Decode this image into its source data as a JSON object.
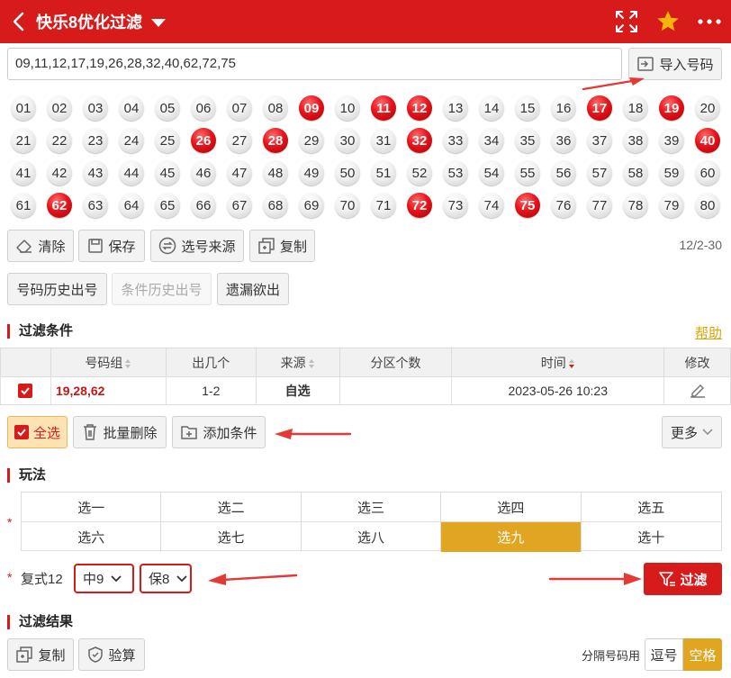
{
  "header": {
    "title": "快乐8优化过滤"
  },
  "input": {
    "value": "09,11,12,17,19,26,28,32,40,62,72,75"
  },
  "buttons": {
    "import": "导入号码",
    "clear": "清除",
    "save": "保存",
    "source": "选号来源",
    "copy": "复制",
    "num_history": "号码历史出号",
    "cond_history": "条件历史出号",
    "missing": "遗漏欲出",
    "select_all": "全选",
    "batch_delete": "批量删除",
    "add_condition": "添加条件",
    "more": "更多",
    "filter": "过滤",
    "copy_result": "复制",
    "verify": "验算"
  },
  "balls": {
    "rows": [
      [
        "01",
        "02",
        "03",
        "04",
        "05",
        "06",
        "07",
        "08",
        "09",
        "10",
        "11",
        "12",
        "13",
        "14",
        "15",
        "16",
        "17",
        "18",
        "19",
        "20"
      ],
      [
        "21",
        "22",
        "23",
        "24",
        "25",
        "26",
        "27",
        "28",
        "29",
        "30",
        "31",
        "32",
        "33",
        "34",
        "35",
        "36",
        "37",
        "38",
        "39",
        "40"
      ],
      [
        "41",
        "42",
        "43",
        "44",
        "45",
        "46",
        "47",
        "48",
        "49",
        "50",
        "51",
        "52",
        "53",
        "54",
        "55",
        "56",
        "57",
        "58",
        "59",
        "60"
      ],
      [
        "61",
        "62",
        "63",
        "64",
        "65",
        "66",
        "67",
        "68",
        "69",
        "70",
        "71",
        "72",
        "73",
        "74",
        "75",
        "76",
        "77",
        "78",
        "79",
        "80"
      ]
    ],
    "selected": [
      "09",
      "11",
      "12",
      "17",
      "19",
      "26",
      "28",
      "32",
      "40",
      "62",
      "72",
      "75"
    ]
  },
  "count": "12/2-30",
  "sections": {
    "conditions": "过滤条件",
    "help": "帮助",
    "play": "玩法",
    "results": "过滤结果"
  },
  "table": {
    "headers": [
      "号码组",
      "出几个",
      "来源",
      "分区个数",
      "时间",
      "修改"
    ],
    "rows": [
      {
        "numbers": "19,28,62",
        "count": "1-2",
        "source": "自选",
        "zones": "",
        "time": "2023-05-26 10:23"
      }
    ]
  },
  "modes": [
    "选一",
    "选二",
    "选三",
    "选四",
    "选五",
    "选六",
    "选七",
    "选八",
    "选九",
    "选十"
  ],
  "active_mode": "选九",
  "options": {
    "label": "复式12",
    "hit": "中9",
    "keep": "保8"
  },
  "separator": {
    "label": "分隔号码用",
    "comma": "逗号",
    "space": "空格"
  },
  "colors": {
    "brand_red": "#d71a1a",
    "accent_gold": "#e0a521"
  }
}
